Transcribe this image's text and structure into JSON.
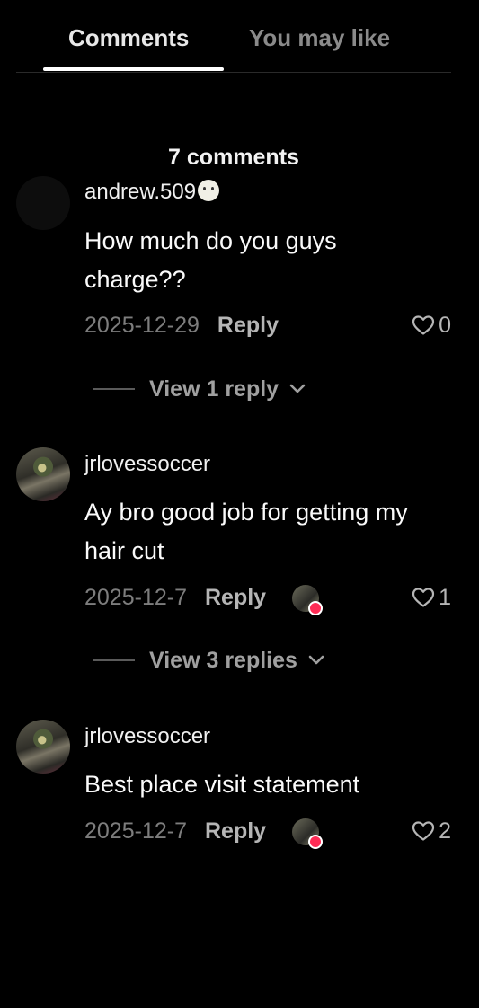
{
  "tabs": {
    "comments": "Comments",
    "you_may_like": "You may like"
  },
  "comment_count": "7 comments",
  "comments": [
    {
      "username": "andrew.509",
      "text": "How much do you guys charge??",
      "date": "2025-12-29",
      "reply_label": "Reply",
      "likes": "0",
      "view_replies": "View 1 reply"
    },
    {
      "username": "jrlovessoccer",
      "text": "Ay bro good job for getting my hair cut",
      "date": "2025-12-7",
      "reply_label": "Reply",
      "likes": "1",
      "view_replies": "View 3 replies",
      "creator_liked": true
    },
    {
      "username": "jrlovessoccer",
      "text": "Best place visit statement",
      "date": "2025-12-7",
      "reply_label": "Reply",
      "likes": "2",
      "creator_liked": true
    }
  ],
  "colors": {
    "background": "#000000",
    "liked_badge": "#fe2c55"
  }
}
